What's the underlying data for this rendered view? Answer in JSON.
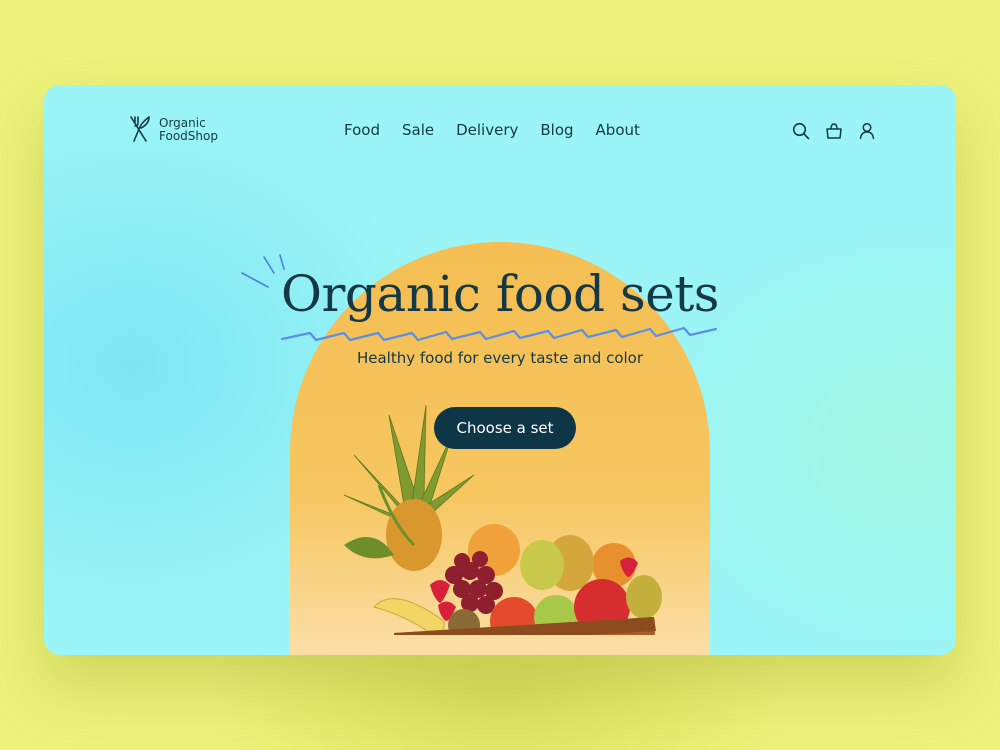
{
  "brand": {
    "line1": "Organic",
    "line2": "FoodShop",
    "logo_icon": "fork-knife-icon"
  },
  "nav": {
    "items": [
      {
        "label": "Food"
      },
      {
        "label": "Sale"
      },
      {
        "label": "Delivery"
      },
      {
        "label": "Blog"
      },
      {
        "label": "About"
      }
    ]
  },
  "header_icons": [
    "search-icon",
    "cart-icon",
    "user-icon"
  ],
  "hero": {
    "title": "Organic food sets",
    "subtitle": "Healthy food for every taste and color",
    "cta_label": "Choose a set",
    "image": "fruit-basket"
  },
  "colors": {
    "page_bg": "#EEF27A",
    "card_bg": "#9BF5F6",
    "arch": "#F4BE52",
    "text": "#153847",
    "cta_bg": "#0E3646",
    "cta_text": "#FFFFFF",
    "accent_squiggle": "#5B8FE6"
  }
}
